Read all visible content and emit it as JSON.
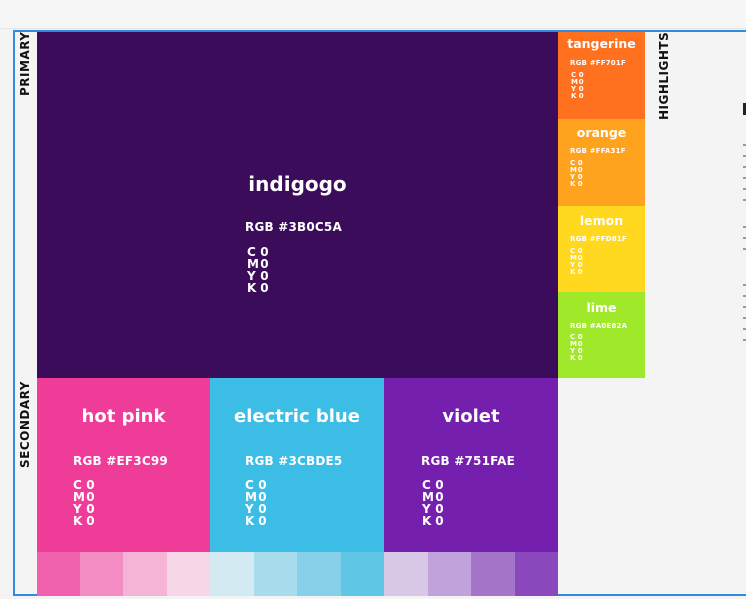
{
  "labels": {
    "primary": "PRIMARY",
    "secondary": "SECONDARY",
    "highlights": "HIGHLIGHTS"
  },
  "primary": {
    "name": "indigogo",
    "rgb": "RGB #3B0C5A",
    "cmyk": {
      "c": "C",
      "cv": "0",
      "m": "M",
      "mv": "0",
      "y": "Y",
      "yv": "0",
      "k": "K",
      "kv": "0"
    },
    "color": "#3b0c5a"
  },
  "secondary": [
    {
      "name": "hot pink",
      "rgb": "RGB #EF3C99",
      "color": "#ef3c99",
      "cmyk": {
        "c": "C",
        "cv": "0",
        "m": "M",
        "mv": "0",
        "y": "Y",
        "yv": "0",
        "k": "K",
        "kv": "0"
      }
    },
    {
      "name": "electric blue",
      "rgb": "RGB #3CBDE5",
      "color": "#3cbde5",
      "cmyk": {
        "c": "C",
        "cv": "0",
        "m": "M",
        "mv": "0",
        "y": "Y",
        "yv": "0",
        "k": "K",
        "kv": "0"
      }
    },
    {
      "name": "violet",
      "rgb": "RGB #751FAE",
      "color": "#751fae",
      "cmyk": {
        "c": "C",
        "cv": "0",
        "m": "M",
        "mv": "0",
        "y": "Y",
        "yv": "0",
        "k": "K",
        "kv": "0"
      }
    }
  ],
  "highlights": [
    {
      "name": "tangerine",
      "rgb": "RGB #FF701F",
      "color": "#ff701f",
      "cmyk": {
        "c": "C",
        "cv": "0",
        "m": "M",
        "mv": "0",
        "y": "Y",
        "yv": "0",
        "k": "K",
        "kv": "0"
      }
    },
    {
      "name": "orange",
      "rgb": "RGB #FFA31F",
      "color": "#ffa31f",
      "cmyk": {
        "c": "C",
        "cv": "0",
        "m": "M",
        "mv": "0",
        "y": "Y",
        "yv": "0",
        "k": "K",
        "kv": "0"
      }
    },
    {
      "name": "lemon",
      "rgb": "RGB #FFD81F",
      "color": "#ffd81f",
      "cmyk": {
        "c": "C",
        "cv": "0",
        "m": "M",
        "mv": "0",
        "y": "Y",
        "yv": "0",
        "k": "K",
        "kv": "0"
      }
    },
    {
      "name": "lime",
      "rgb": "RGB #A0E82A",
      "color": "#a0e82a",
      "cmyk": {
        "c": "C",
        "cv": "0",
        "m": "M",
        "mv": "0",
        "y": "Y",
        "yv": "0",
        "k": "K",
        "kv": "0"
      }
    }
  ],
  "tints": {
    "hot_pink": [
      "#f061ad",
      "#f38cc3",
      "#f5b3d6",
      "#f6d6e7"
    ],
    "electric_blue": [
      "#d3eaf2",
      "#a9dcec",
      "#86d1e9",
      "#5fc6e6"
    ],
    "violet": [
      "#d9c7e7",
      "#c2a2dc",
      "#a575cc",
      "#8b47bc"
    ]
  },
  "colors": {
    "frame_border": "#2d8ee0",
    "background": "#f4f4f4"
  }
}
